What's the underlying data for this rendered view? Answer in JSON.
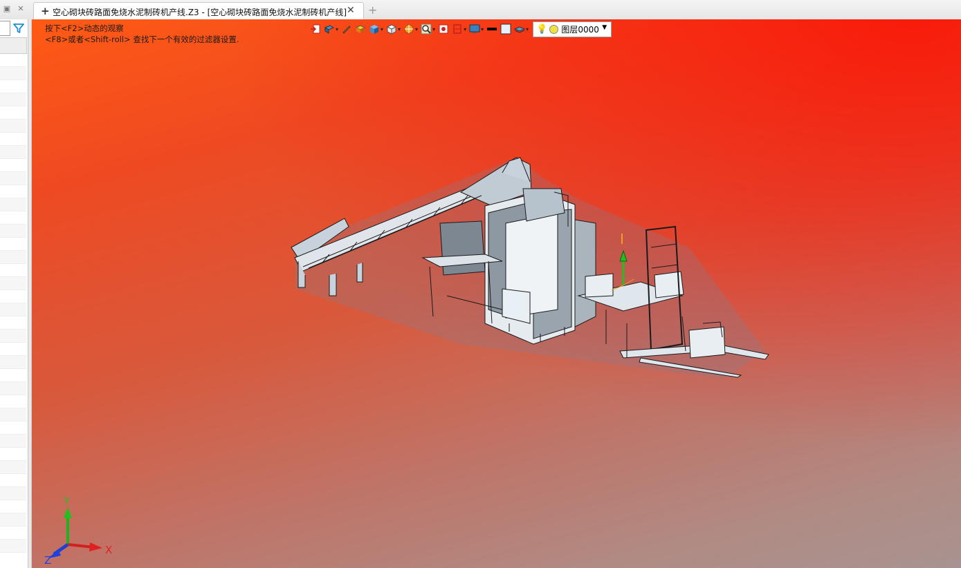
{
  "window": {
    "tab_title": "空心砌块砖路面免烧水泥制砖机产线.Z3 - [空心砌块砖路面免烧水泥制砖机产线]",
    "new_tab_symbol": "+",
    "tab_plus_symbol": "+",
    "tab_close_symbol": "✕",
    "ctrl_restore_symbol": "▣",
    "ctrl_close_symbol": "✕"
  },
  "viewport": {
    "hint_line1": "按下<F2>动态的观察",
    "hint_line2": "<F8>或者<Shift-roll> 查找下一个有效的过滤器设置.",
    "layer_label": "图层0000",
    "layer_color": "#f0e040",
    "axis_x": "X",
    "axis_y": "Y",
    "axis_z": "Z"
  },
  "toolbar": {
    "icons": [
      "exit-sketch-icon",
      "view-orient-icon",
      "pen-icon",
      "render-box-icon",
      "shaded-cube-icon",
      "wire-cube-icon",
      "color-wheel-icon",
      "zoom-icon",
      "record-icon",
      "section-icon",
      "display-icon",
      "line-color-swatch",
      "fill-swatch",
      "layer-stack-icon"
    ]
  },
  "colors": {
    "filter_icon": "#1a8fd6",
    "axis_x": "#e02020",
    "axis_y": "#20c020",
    "axis_z": "#2040e0"
  }
}
